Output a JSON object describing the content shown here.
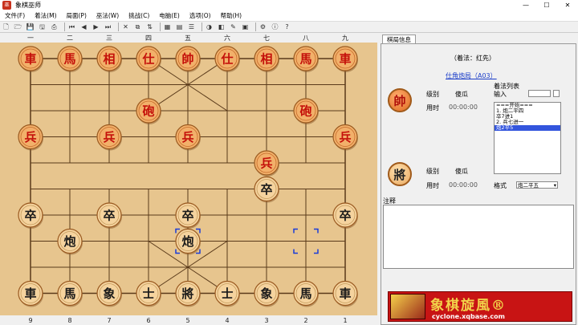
{
  "window": {
    "title": "象棋巫师",
    "app_icon": "巫",
    "min": "—",
    "max": "☐",
    "close": "✕"
  },
  "menu": [
    {
      "name": "menu-file",
      "label": "文件(F)"
    },
    {
      "name": "menu-notation",
      "label": "着法(M)"
    },
    {
      "name": "menu-position",
      "label": "局面(P)"
    },
    {
      "name": "menu-wizard",
      "label": "巫法(W)"
    },
    {
      "name": "menu-challenge",
      "label": "挑战(C)"
    },
    {
      "name": "menu-engine",
      "label": "电脑(E)"
    },
    {
      "name": "menu-options",
      "label": "选项(O)"
    },
    {
      "name": "menu-help",
      "label": "帮助(H)"
    }
  ],
  "toolbar": [
    {
      "name": "new-icon",
      "glyph": "🗋"
    },
    {
      "name": "open-icon",
      "glyph": "🗁"
    },
    {
      "name": "save-icon",
      "glyph": "💾"
    },
    {
      "name": "save-as-icon",
      "glyph": "🖫"
    },
    {
      "name": "print-icon",
      "glyph": "⎙"
    },
    {
      "sep": true
    },
    {
      "name": "first-move-icon",
      "glyph": "⏮"
    },
    {
      "name": "prev-move-icon",
      "glyph": "◀"
    },
    {
      "name": "next-move-icon",
      "glyph": "▶"
    },
    {
      "name": "last-move-icon",
      "glyph": "⏭"
    },
    {
      "sep": true
    },
    {
      "name": "delete-move-icon",
      "glyph": "✕"
    },
    {
      "name": "copy-icon",
      "glyph": "⧉"
    },
    {
      "name": "flip-board-icon",
      "glyph": "⇅"
    },
    {
      "sep": true
    },
    {
      "name": "edit-position-icon",
      "glyph": "▦"
    },
    {
      "name": "board-icon",
      "glyph": "▤"
    },
    {
      "name": "list-icon",
      "glyph": "☰"
    },
    {
      "sep": true
    },
    {
      "name": "color-icon",
      "glyph": "◑"
    },
    {
      "name": "engine-icon",
      "glyph": "◧"
    },
    {
      "name": "hint-icon",
      "glyph": "✎"
    },
    {
      "name": "book-icon",
      "glyph": "▣"
    },
    {
      "sep": true
    },
    {
      "name": "settings-icon",
      "glyph": "⚙"
    },
    {
      "name": "info-icon",
      "glyph": "ⓘ"
    },
    {
      "name": "help-icon",
      "glyph": "?"
    }
  ],
  "board": {
    "top_files": [
      "一",
      "二",
      "三",
      "四",
      "五",
      "六",
      "七",
      "八",
      "九"
    ],
    "bottom_files": [
      "9",
      "8",
      "7",
      "6",
      "5",
      "4",
      "3",
      "2",
      "1"
    ],
    "pieces": [
      {
        "c": 0,
        "r": 0,
        "t": "車",
        "side": "red"
      },
      {
        "c": 1,
        "r": 0,
        "t": "馬",
        "side": "red"
      },
      {
        "c": 2,
        "r": 0,
        "t": "相",
        "side": "red"
      },
      {
        "c": 3,
        "r": 0,
        "t": "仕",
        "side": "red"
      },
      {
        "c": 4,
        "r": 0,
        "t": "帥",
        "side": "red"
      },
      {
        "c": 5,
        "r": 0,
        "t": "仕",
        "side": "red"
      },
      {
        "c": 6,
        "r": 0,
        "t": "相",
        "side": "red"
      },
      {
        "c": 7,
        "r": 0,
        "t": "馬",
        "side": "red"
      },
      {
        "c": 8,
        "r": 0,
        "t": "車",
        "side": "red"
      },
      {
        "c": 3,
        "r": 2,
        "t": "砲",
        "side": "red"
      },
      {
        "c": 7,
        "r": 2,
        "t": "砲",
        "side": "red"
      },
      {
        "c": 0,
        "r": 3,
        "t": "兵",
        "side": "red"
      },
      {
        "c": 2,
        "r": 3,
        "t": "兵",
        "side": "red"
      },
      {
        "c": 4,
        "r": 3,
        "t": "兵",
        "side": "red"
      },
      {
        "c": 8,
        "r": 3,
        "t": "兵",
        "side": "red"
      },
      {
        "c": 6,
        "r": 4,
        "t": "兵",
        "side": "red"
      },
      {
        "c": 6,
        "r": 5,
        "t": "卒",
        "side": "black"
      },
      {
        "c": 0,
        "r": 6,
        "t": "卒",
        "side": "black"
      },
      {
        "c": 2,
        "r": 6,
        "t": "卒",
        "side": "black"
      },
      {
        "c": 4,
        "r": 6,
        "t": "卒",
        "side": "black"
      },
      {
        "c": 8,
        "r": 6,
        "t": "卒",
        "side": "black"
      },
      {
        "c": 1,
        "r": 7,
        "t": "炮",
        "side": "black"
      },
      {
        "c": 4,
        "r": 7,
        "t": "炮",
        "side": "black"
      },
      {
        "c": 0,
        "r": 9,
        "t": "車",
        "side": "black"
      },
      {
        "c": 1,
        "r": 9,
        "t": "馬",
        "side": "black"
      },
      {
        "c": 2,
        "r": 9,
        "t": "象",
        "side": "black"
      },
      {
        "c": 3,
        "r": 9,
        "t": "士",
        "side": "black"
      },
      {
        "c": 4,
        "r": 9,
        "t": "將",
        "side": "black"
      },
      {
        "c": 5,
        "r": 9,
        "t": "士",
        "side": "black"
      },
      {
        "c": 6,
        "r": 9,
        "t": "象",
        "side": "black"
      },
      {
        "c": 7,
        "r": 9,
        "t": "馬",
        "side": "black"
      },
      {
        "c": 8,
        "r": 9,
        "t": "車",
        "side": "black"
      }
    ],
    "selected_from": {
      "c": 7,
      "r": 7
    },
    "selected_to": {
      "c": 4,
      "r": 7
    }
  },
  "panel": {
    "tab_label": "棋局信息",
    "first_move": "（着法：红先）",
    "opening_link": "仕角炮局（A03）",
    "red_player": {
      "glyph": "帥",
      "level_label": "级别",
      "level_value": "傻瓜",
      "time_label": "用时",
      "time_value": "00:00:00"
    },
    "black_player": {
      "glyph": "將",
      "level_label": "级别",
      "level_value": "傻瓜",
      "time_label": "用时",
      "time_value": "00:00:00"
    },
    "moves_group_label": "着法列表",
    "moves_input_label": "输入",
    "moves": [
      "===开始===",
      "1. 炮二平四",
      "   卒7进1",
      "2. 兵七进一",
      "   炮2平5"
    ],
    "moves_selected_index": 4,
    "format_label": "格式",
    "format_value": "炮二平五",
    "notes_label": "注释",
    "banner_main": "象棋旋風®",
    "banner_sub": "cyclone.xqbase.com"
  }
}
